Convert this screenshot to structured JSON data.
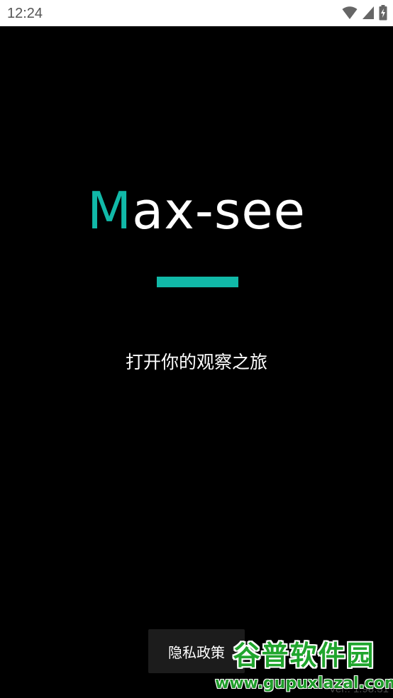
{
  "status_bar": {
    "time": "12:24",
    "icons": [
      "wifi-icon",
      "signal-icon",
      "battery-charging-icon"
    ]
  },
  "splash": {
    "logo_accent": "M",
    "logo_rest": "ax-see",
    "tagline": "打开你的观察之旅"
  },
  "privacy_button": {
    "label": "隐私政策"
  },
  "version": "Ver.: 1.98.31",
  "watermark": {
    "title": "谷普软件园",
    "url": "www.gupuxlazal.com"
  },
  "colors": {
    "accent": "#11b9a8",
    "background": "#000000",
    "status_bar": "#ffffff"
  }
}
